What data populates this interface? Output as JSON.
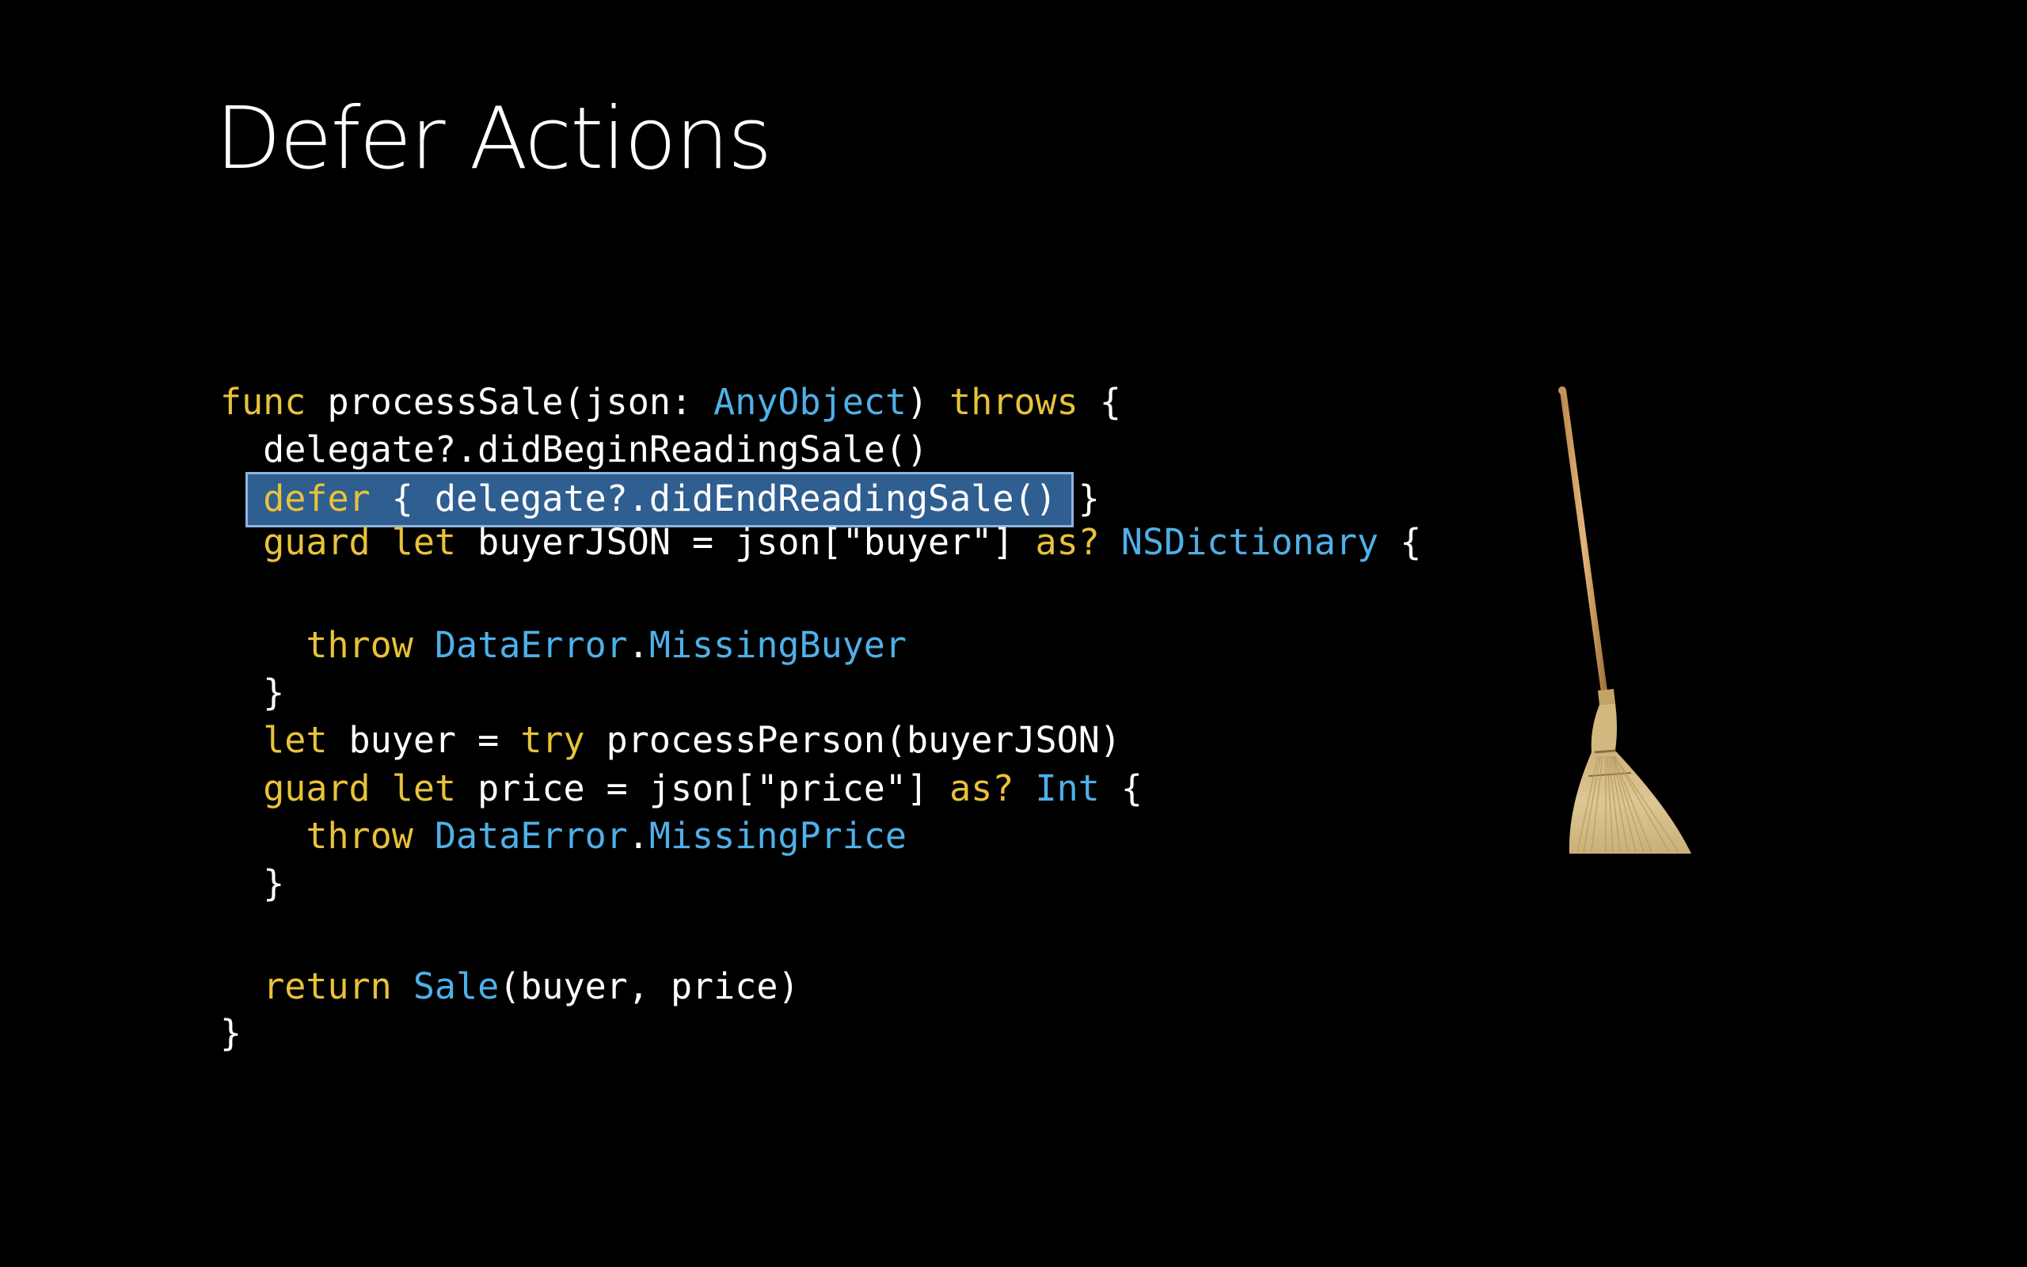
{
  "slide": {
    "title": "Defer Actions"
  },
  "colors": {
    "background": "#000000",
    "keyword": "#e8c23a",
    "type": "#4fb0e8",
    "plain": "#ffffff",
    "highlight_fill": "#2f5e90",
    "highlight_border": "#8fb4dc"
  },
  "broom_icon": "broom-icon",
  "code": {
    "highlighted_line": 2,
    "lines": [
      {
        "tokens": [
          {
            "t": "func",
            "k": "kw"
          },
          {
            "t": " processSale(json: ",
            "k": "plain"
          },
          {
            "t": "AnyObject",
            "k": "type"
          },
          {
            "t": ") ",
            "k": "plain"
          },
          {
            "t": "throws",
            "k": "kw"
          },
          {
            "t": " {",
            "k": "plain"
          }
        ]
      },
      {
        "tokens": [
          {
            "t": "  delegate?.didBeginReadingSale()",
            "k": "plain"
          }
        ]
      },
      {
        "tokens": [
          {
            "t": "  ",
            "k": "plain"
          },
          {
            "t": "defer",
            "k": "kw"
          },
          {
            "t": " { delegate?.didEndReadingSale() }",
            "k": "plain"
          }
        ]
      },
      {
        "tokens": [
          {
            "t": "  ",
            "k": "plain"
          },
          {
            "t": "guard",
            "k": "kw"
          },
          {
            "t": " ",
            "k": "plain"
          },
          {
            "t": "let",
            "k": "kw"
          },
          {
            "t": " buyerJSON = json[\"buyer\"] ",
            "k": "plain"
          },
          {
            "t": "as?",
            "k": "kw"
          },
          {
            "t": " ",
            "k": "plain"
          },
          {
            "t": "NSDictionary",
            "k": "type"
          },
          {
            "t": " {",
            "k": "plain"
          }
        ]
      },
      {
        "tokens": [
          {
            "t": "    ",
            "k": "plain"
          },
          {
            "t": "throw",
            "k": "kw"
          },
          {
            "t": " ",
            "k": "plain"
          },
          {
            "t": "DataError",
            "k": "type"
          },
          {
            "t": ".",
            "k": "plain"
          },
          {
            "t": "MissingBuyer",
            "k": "type"
          }
        ]
      },
      {
        "tokens": [
          {
            "t": "  }",
            "k": "plain"
          }
        ]
      },
      {
        "tokens": [
          {
            "t": "  ",
            "k": "plain"
          },
          {
            "t": "let",
            "k": "kw"
          },
          {
            "t": " buyer = ",
            "k": "plain"
          },
          {
            "t": "try",
            "k": "kw"
          },
          {
            "t": " processPerson(buyerJSON)",
            "k": "plain"
          }
        ]
      },
      {
        "tokens": [
          {
            "t": "  ",
            "k": "plain"
          },
          {
            "t": "guard",
            "k": "kw"
          },
          {
            "t": " ",
            "k": "plain"
          },
          {
            "t": "let",
            "k": "kw"
          },
          {
            "t": " price = json[\"price\"] ",
            "k": "plain"
          },
          {
            "t": "as?",
            "k": "kw"
          },
          {
            "t": " ",
            "k": "plain"
          },
          {
            "t": "Int",
            "k": "type"
          },
          {
            "t": " {",
            "k": "plain"
          }
        ]
      },
      {
        "tokens": [
          {
            "t": "    ",
            "k": "plain"
          },
          {
            "t": "throw",
            "k": "kw"
          },
          {
            "t": " ",
            "k": "plain"
          },
          {
            "t": "DataError",
            "k": "type"
          },
          {
            "t": ".",
            "k": "plain"
          },
          {
            "t": "MissingPrice",
            "k": "type"
          }
        ]
      },
      {
        "tokens": [
          {
            "t": "  }",
            "k": "plain"
          }
        ]
      },
      {
        "tokens": [
          {
            "t": "  ",
            "k": "plain"
          },
          {
            "t": "return",
            "k": "kw"
          },
          {
            "t": " ",
            "k": "plain"
          },
          {
            "t": "Sale",
            "k": "type"
          },
          {
            "t": "(buyer, price)",
            "k": "plain"
          }
        ]
      },
      {
        "tokens": [
          {
            "t": "}",
            "k": "plain"
          }
        ]
      }
    ]
  }
}
